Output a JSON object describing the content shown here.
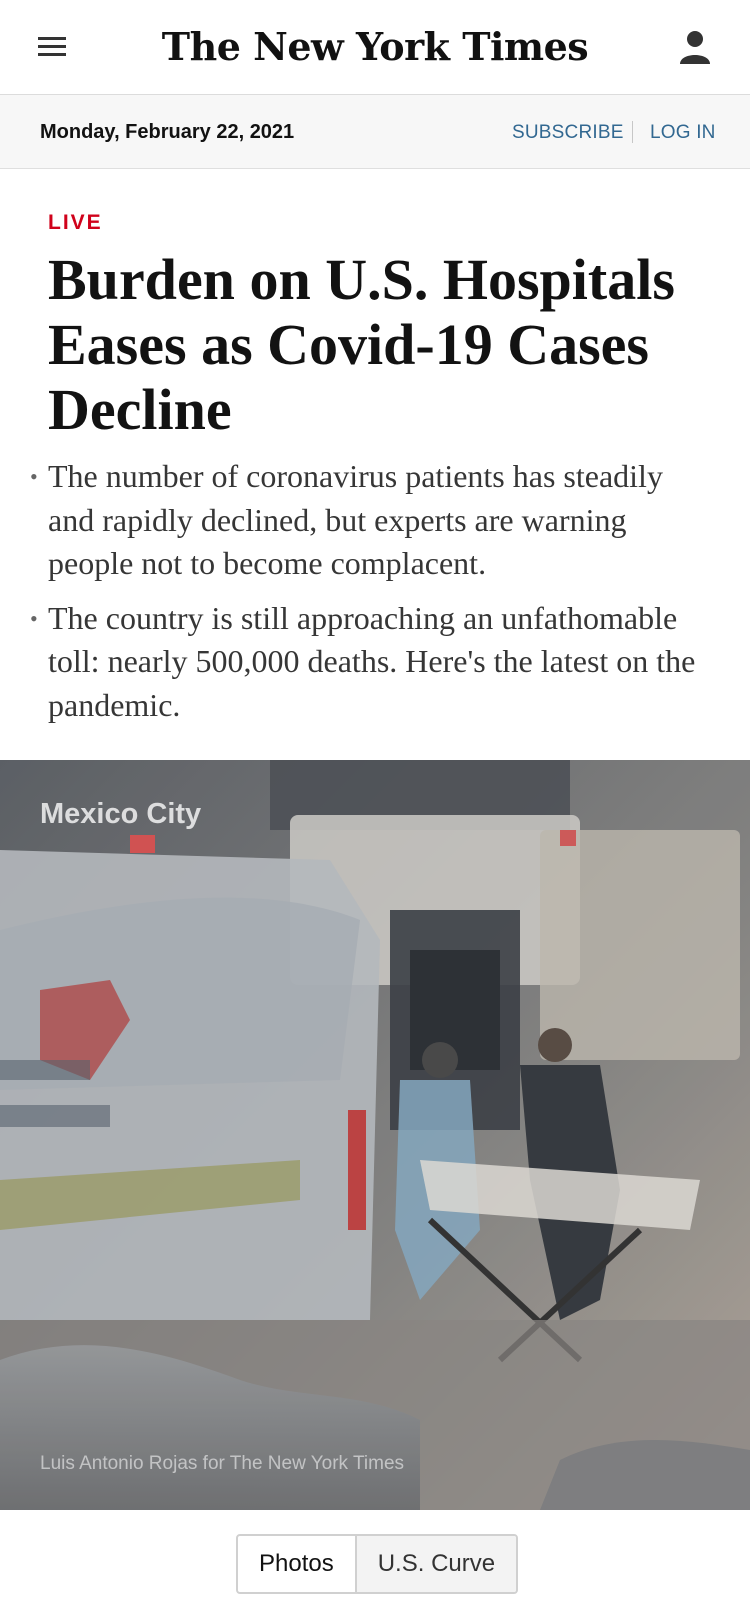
{
  "masthead": {
    "logo_text": "The New York Times",
    "menu_icon": "hamburger-menu-icon",
    "account_icon": "user-account-icon"
  },
  "date_bar": {
    "date": "Monday, February 22, 2021",
    "subscribe_label": "SUBSCRIBE",
    "login_label": "LOG IN"
  },
  "article": {
    "kicker": "LIVE",
    "headline": "Burden on U.S. Hospitals Eases as Covid-19 Cases Decline",
    "summary": [
      "The number of coronavirus patients has steadily and rapidly declined, but experts are warning people not to become complacent.",
      "The country is still approaching an unfathomable toll: nearly 500,000 deaths. Here's the latest on the pandemic."
    ]
  },
  "photo": {
    "location": "Mexico City",
    "credit": "Luis Antonio Rojas for The New York Times"
  },
  "tabs": [
    {
      "label": "Photos"
    },
    {
      "label": "U.S. Curve"
    }
  ],
  "colors": {
    "live_red": "#d0021b",
    "link_blue": "#326891",
    "datebar_bg": "#f7f7f7"
  }
}
